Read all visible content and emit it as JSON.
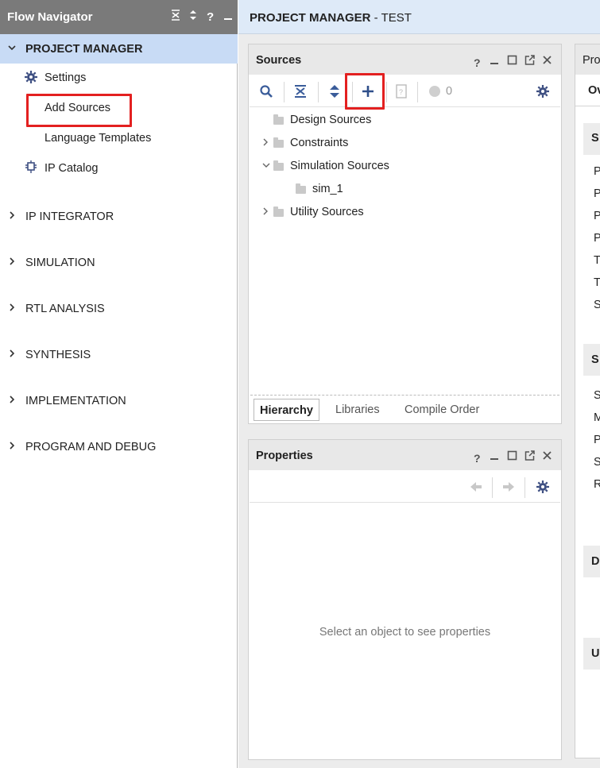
{
  "flow_navigator": {
    "title": "Flow Navigator",
    "header_icons": [
      "collapse-all-icon",
      "expand-all-icon",
      "help-icon",
      "minimize-icon"
    ],
    "help_glyph": "?",
    "project_manager": {
      "label": "PROJECT MANAGER",
      "items": [
        {
          "label": "Settings",
          "icon": "gear-icon"
        },
        {
          "label": "Add Sources"
        },
        {
          "label": "Language Templates"
        },
        {
          "label": "IP Catalog",
          "icon": "ip-catalog-icon"
        }
      ]
    },
    "sections": [
      {
        "label": "IP INTEGRATOR"
      },
      {
        "label": "SIMULATION"
      },
      {
        "label": "RTL ANALYSIS"
      },
      {
        "label": "SYNTHESIS"
      },
      {
        "label": "IMPLEMENTATION"
      },
      {
        "label": "PROGRAM AND DEBUG"
      }
    ]
  },
  "main": {
    "title_bold": "PROJECT MANAGER",
    "title_rest": " - TEST"
  },
  "sources": {
    "title": "Sources",
    "header_glyph": "?",
    "toolbar": {
      "icons": [
        "search-icon",
        "collapse-all-icon",
        "expand-all-icon",
        "add-sources-icon",
        "unknown-file-icon",
        "status-dot-icon",
        "gear-icon"
      ],
      "count": "0"
    },
    "tree": [
      {
        "label": "Design Sources"
      },
      {
        "label": "Constraints"
      },
      {
        "label": "Simulation Sources"
      },
      {
        "label": "sim_1"
      },
      {
        "label": "Utility Sources"
      }
    ],
    "tabs": [
      {
        "label": "Hierarchy",
        "active": true
      },
      {
        "label": "Libraries"
      },
      {
        "label": "Compile Order"
      }
    ]
  },
  "properties": {
    "title": "Properties",
    "header_glyph": "?",
    "empty_message": "Select an object to see properties"
  },
  "right_panel": {
    "title": "Pro",
    "tab": "Ov",
    "sections": [
      {
        "label": "S",
        "rows": [
          "P",
          "P",
          "P",
          "P",
          "T",
          "T",
          "S"
        ]
      },
      {
        "label": "S",
        "rows": [
          "S",
          "M",
          "P",
          "S",
          "R"
        ]
      },
      {
        "label": "D",
        "rows": []
      },
      {
        "label": "U",
        "rows": []
      }
    ]
  },
  "colors": {
    "nav_header": "#7a7a7a",
    "selected_row": "#c8dbf5",
    "highlight_box": "#e32020",
    "icon_blue": "#3a5c9a"
  }
}
